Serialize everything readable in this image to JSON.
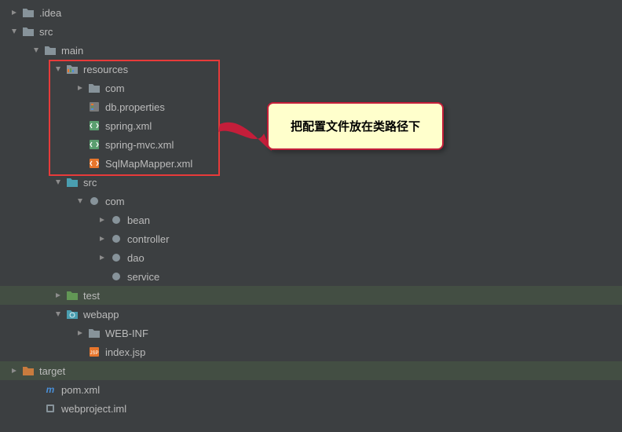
{
  "tree": {
    "idea": ".idea",
    "src": "src",
    "main": "main",
    "resources": "resources",
    "com1": "com",
    "db_properties": "db.properties",
    "spring_xml": "spring.xml",
    "spring_mvc_xml": "spring-mvc.xml",
    "sqlmap_xml": "SqlMapMapper.xml",
    "src2": "src",
    "com2": "com",
    "bean": "bean",
    "controller": "controller",
    "dao": "dao",
    "service": "service",
    "test": "test",
    "webapp": "webapp",
    "webinf": "WEB-INF",
    "index_jsp": "index.jsp",
    "target": "target",
    "pom_xml": "pom.xml",
    "webproject_iml": "webproject.iml"
  },
  "callout": {
    "text": "把配置文件放在类路径下"
  },
  "colors": {
    "folder_blue": "#87939A",
    "folder_orange": "#C87B3E",
    "folder_green": "#629755",
    "folder_teal": "#4A9EB0",
    "xml_orange": "#E8762C",
    "xml_green": "#5A9E6F",
    "maven_blue": "#4A90D9"
  }
}
